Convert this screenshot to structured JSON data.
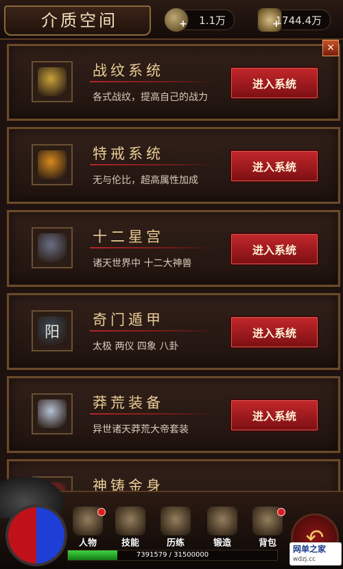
{
  "header": {
    "title": "介质空间",
    "currency1": "1.1万",
    "currency2": "1744.4万"
  },
  "close_icon": "close-icon",
  "systems": [
    {
      "title": "战纹系统",
      "desc": "各式战纹，提高自己的战力",
      "button": "进入系统",
      "icon": "shield-icon",
      "color": "#c8a23a"
    },
    {
      "title": "特戒系统",
      "desc": "无与伦比，超高属性加成",
      "button": "进入系统",
      "icon": "ring-icon",
      "color": "#d88a1e"
    },
    {
      "title": "十二星宫",
      "desc": "诸天世界中 十二大神兽",
      "button": "进入系统",
      "icon": "dragon-head-icon",
      "color": "#6a6f86"
    },
    {
      "title": "奇门遁甲",
      "desc": "太极 两仪 四象 八卦",
      "button": "进入系统",
      "icon": "yang-seal-icon",
      "icon_text": "阳",
      "color": "#3b4a5a"
    },
    {
      "title": "莽荒装备",
      "desc": "异世诸天莽荒大帝套装",
      "button": "进入系统",
      "icon": "armor-icon",
      "color": "#b7c2d6"
    },
    {
      "title": "神铸金身",
      "desc": "",
      "button": "",
      "icon": "golden-body-icon",
      "color": "#b3262a"
    }
  ],
  "nav": [
    {
      "label": "人物",
      "icon": "character-icon",
      "badge": true
    },
    {
      "label": "技能",
      "icon": "skill-book-icon",
      "badge": false
    },
    {
      "label": "历练",
      "icon": "training-icon",
      "badge": false
    },
    {
      "label": "锻造",
      "icon": "forge-icon",
      "badge": false
    },
    {
      "label": "背包",
      "icon": "backpack-icon",
      "badge": true
    }
  ],
  "exp": {
    "text": "7391579 / 31500000",
    "fraction": 0.2346
  },
  "watermark": {
    "line1": "网单之家",
    "line2": "wdzj.cc"
  }
}
